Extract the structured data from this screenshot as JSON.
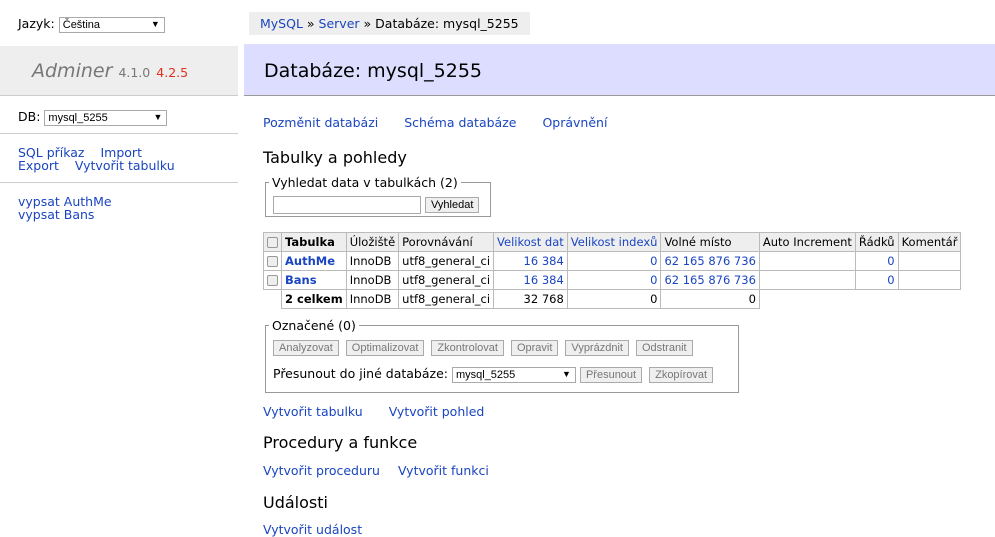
{
  "sidebar": {
    "lang_label": "Jazyk:",
    "lang_value": "Čeština",
    "logo": "Adminer",
    "version": "4.1.0",
    "version_new": "4.2.5",
    "db_label": "DB:",
    "db_value": "mysql_5255",
    "links": [
      "SQL příkaz",
      "Import",
      "Export",
      "Vytvořit tabulku"
    ],
    "tables": [
      "vypsat AuthMe",
      "vypsat Bans"
    ]
  },
  "breadcrumb": {
    "mysql": "MySQL",
    "server": "Server",
    "current": "Databáze: mysql_5255",
    "sep": "»"
  },
  "page_title": "Databáze: mysql_5255",
  "nav": [
    "Pozměnit databázi",
    "Schéma databáze",
    "Oprávnění"
  ],
  "tables_section": {
    "title": "Tabulky a pohledy",
    "search_legend": "Vyhledat data v tabulkách (2)",
    "search_button": "Vyhledat",
    "headers": [
      "Tabulka",
      "Úložiště",
      "Porovnávání",
      "Velikost dat",
      "Velikost indexů",
      "Volné místo",
      "Auto Increment",
      "Řádků",
      "Komentář"
    ],
    "rows": [
      {
        "name": "AuthMe",
        "engine": "InnoDB",
        "collation": "utf8_general_ci",
        "data": "16 384",
        "index": "0",
        "free": "62 165 876 736",
        "ai": "",
        "rows": "0",
        "comment": ""
      },
      {
        "name": "Bans",
        "engine": "InnoDB",
        "collation": "utf8_general_ci",
        "data": "16 384",
        "index": "0",
        "free": "62 165 876 736",
        "ai": "",
        "rows": "0",
        "comment": ""
      }
    ],
    "total": {
      "name": "2 celkem",
      "engine": "InnoDB",
      "collation": "utf8_general_ci",
      "data": "32 768",
      "index": "0",
      "free": "0"
    }
  },
  "selected": {
    "legend": "Označené (0)",
    "buttons": [
      "Analyzovat",
      "Optimalizovat",
      "Zkontrolovat",
      "Opravit",
      "Vyprázdnit",
      "Odstranit"
    ],
    "move_label": "Přesunout do jiné databáze:",
    "move_db": "mysql_5255",
    "move_button": "Přesunout",
    "copy_button": "Zkopírovat"
  },
  "create_links": [
    "Vytvořit tabulku",
    "Vytvořit pohled"
  ],
  "procedures": {
    "title": "Procedury a funkce",
    "links": [
      "Vytvořit proceduru",
      "Vytvořit funkci"
    ]
  },
  "events": {
    "title": "Události",
    "link": "Vytvořit událost"
  }
}
